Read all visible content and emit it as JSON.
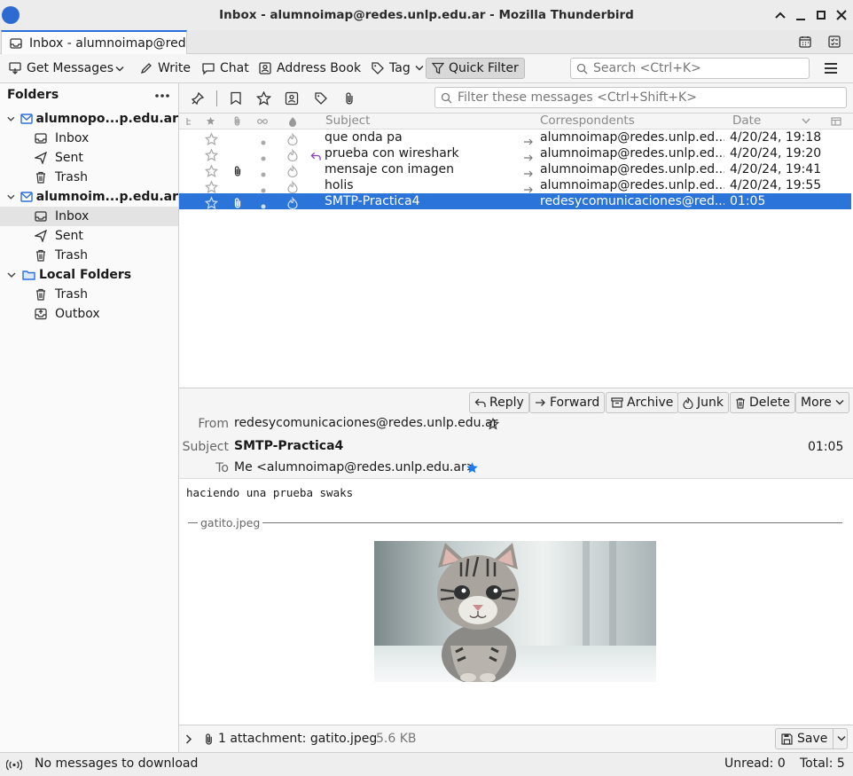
{
  "window": {
    "title": "Inbox - alumnoimap@redes.unlp.edu.ar - Mozilla Thunderbird"
  },
  "tab": {
    "label": "Inbox - alumnoimap@red"
  },
  "toolbar": {
    "get_messages": "Get Messages",
    "write": "Write",
    "chat": "Chat",
    "address_book": "Address Book",
    "tag": "Tag",
    "quick_filter": "Quick Filter",
    "search_placeholder": "Search <Ctrl+K>"
  },
  "folders": {
    "header": "Folders",
    "accounts": [
      {
        "name": "alumnopo...p.edu.ar",
        "folders": [
          "Inbox",
          "Sent",
          "Trash"
        ]
      },
      {
        "name": "alumnoim...p.edu.ar",
        "folders": [
          "Inbox",
          "Sent",
          "Trash"
        ]
      },
      {
        "name": "Local Folders",
        "folders": [
          "Trash",
          "Outbox"
        ]
      }
    ],
    "selected": "alumnoim...p.edu.ar/Inbox"
  },
  "quickfilter": {
    "filter_placeholder": "Filter these messages <Ctrl+Shift+K>"
  },
  "columns": {
    "subject": "Subject",
    "correspondents": "Correspondents",
    "date": "Date"
  },
  "messages": [
    {
      "subject": "que onda pa",
      "correspondent": "alumnoimap@redes.unlp.ed...",
      "date": "4/20/24, 19:18",
      "attachment": false,
      "replied": false,
      "selected": false
    },
    {
      "subject": "prueba con wireshark",
      "correspondent": "alumnoimap@redes.unlp.ed...",
      "date": "4/20/24, 19:20",
      "attachment": false,
      "replied": true,
      "selected": false
    },
    {
      "subject": "mensaje con imagen",
      "correspondent": "alumnoimap@redes.unlp.ed...",
      "date": "4/20/24, 19:41",
      "attachment": true,
      "replied": false,
      "selected": false
    },
    {
      "subject": "holis",
      "correspondent": "alumnoimap@redes.unlp.ed...",
      "date": "4/20/24, 19:55",
      "attachment": false,
      "replied": false,
      "selected": false
    },
    {
      "subject": "SMTP-Practica4",
      "correspondent": "redesycomunicaciones@red...",
      "date": "01:05",
      "attachment": true,
      "replied": false,
      "selected": true
    }
  ],
  "header_buttons": {
    "reply": "Reply",
    "forward": "Forward",
    "archive": "Archive",
    "junk": "Junk",
    "delete": "Delete",
    "more": "More"
  },
  "message": {
    "from_label": "From",
    "from": "redesycomunicaciones@redes.unlp.edu.ar",
    "subject_label": "Subject",
    "subject": "SMTP-Practica4",
    "time": "01:05",
    "to_label": "To",
    "to": "Me <alumnoimap@redes.unlp.edu.ar>",
    "body": "haciendo una prueba swaks",
    "attachment_name": "gatito.jpeg"
  },
  "attachments": {
    "summary": "1 attachment: gatito.jpeg",
    "size": "5.6 KB",
    "save": "Save"
  },
  "status": {
    "left": "No messages to download",
    "unread": "Unread: 0",
    "total": "Total: 5"
  },
  "colors": {
    "selection": "#2a74da",
    "accent": "#2a6fdb",
    "reply": "#8a3fc1",
    "star_blue": "#1a7cf0"
  }
}
